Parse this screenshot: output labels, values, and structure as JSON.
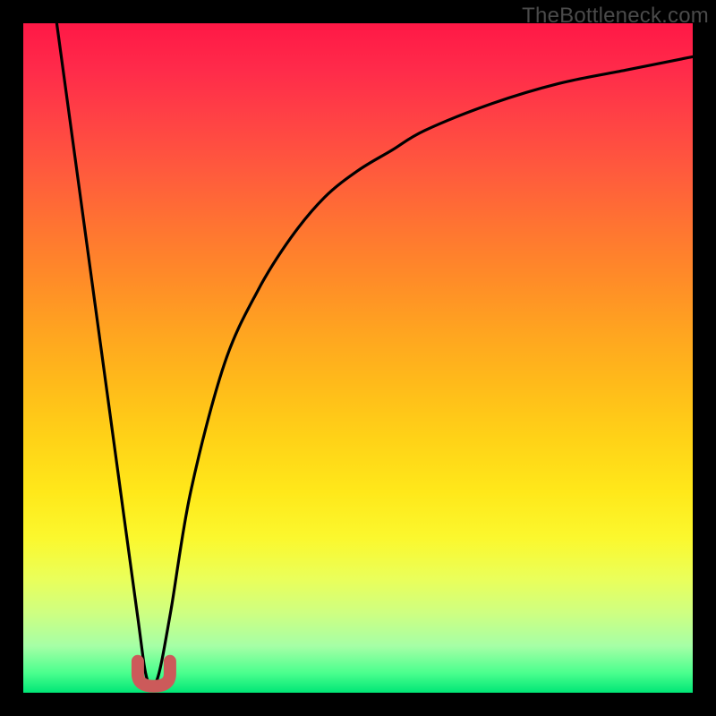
{
  "watermark_text": "TheBottleneck.com",
  "chart_data": {
    "type": "line",
    "title": "",
    "xlabel": "",
    "ylabel": "",
    "xlim": [
      0,
      100
    ],
    "ylim": [
      0,
      100
    ],
    "grid": false,
    "series": [
      {
        "name": "bottleneck-curve",
        "x": [
          5,
          8,
          11,
          14,
          17,
          18.5,
          20,
          22,
          25,
          30,
          35,
          40,
          45,
          50,
          55,
          60,
          70,
          80,
          90,
          100
        ],
        "y": [
          100,
          78,
          56,
          34,
          12,
          2,
          2,
          12,
          30,
          49,
          60,
          68,
          74,
          78,
          81,
          84,
          88,
          91,
          93,
          95
        ]
      }
    ],
    "annotations": [
      {
        "name": "optimal-marker",
        "x": 19.5,
        "y": 1.5,
        "shape": "u"
      }
    ],
    "colors": {
      "curve": "#000000",
      "marker": "#cc5a5a",
      "gradient_top": "#ff1846",
      "gradient_mid": "#ffe81a",
      "gradient_bottom": "#00e676"
    }
  }
}
